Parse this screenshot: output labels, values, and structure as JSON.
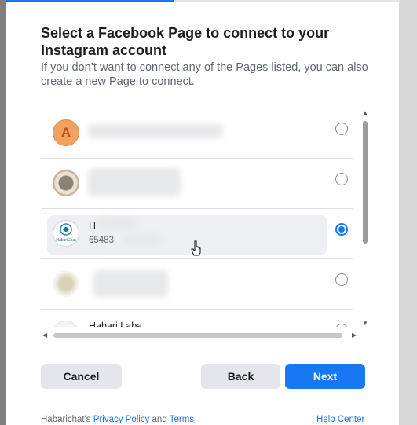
{
  "dialog": {
    "title": "Select a Facebook Page to connect to your Instagram account",
    "subtitle": "If you don’t want to connect any of the Pages listed, you can also create a new Page to connect."
  },
  "pages": [
    {
      "avatar_text": "A",
      "avatar": "letter-avatar",
      "name": "",
      "id": "",
      "selected": false
    },
    {
      "avatar_text": "",
      "avatar": "photo-avatar",
      "name": "",
      "id": "",
      "selected": false
    },
    {
      "avatar_text": "",
      "avatar": "habarichat-logo",
      "name": "H",
      "id": "65483",
      "selected": true
    },
    {
      "avatar_text": "",
      "avatar": "photo-avatar",
      "name": "",
      "id": "",
      "selected": false
    },
    {
      "avatar_text": "",
      "avatar": "logo-avatar",
      "name": "Habari Laba",
      "id": "",
      "selected": false
    }
  ],
  "logo_text": "HabariChat",
  "buttons": {
    "cancel": "Cancel",
    "back": "Back",
    "next": "Next"
  },
  "footer": {
    "prefix": "Habarichat's ",
    "privacy": "Privacy Policy",
    "and": " and ",
    "terms": "Terms",
    "help": "Help Center"
  },
  "colors": {
    "accent": "#1877f2",
    "avatar_orange": "#f2a15f"
  }
}
